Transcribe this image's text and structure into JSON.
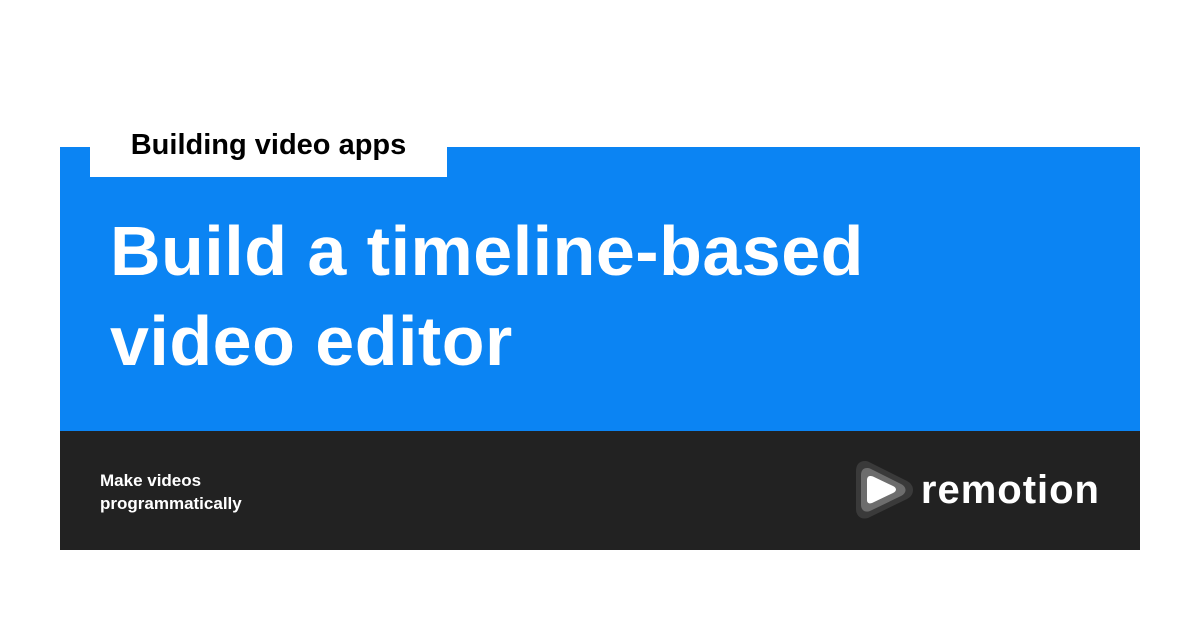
{
  "category_tag": "Building video apps",
  "title_lines": [
    "Build a timeline-based",
    "video editor"
  ],
  "footer": {
    "tagline_lines": [
      "Make videos",
      "programmatically"
    ],
    "logo_text": "remotion"
  },
  "colors": {
    "accent": "#0b84f3",
    "footer": "#222222"
  }
}
